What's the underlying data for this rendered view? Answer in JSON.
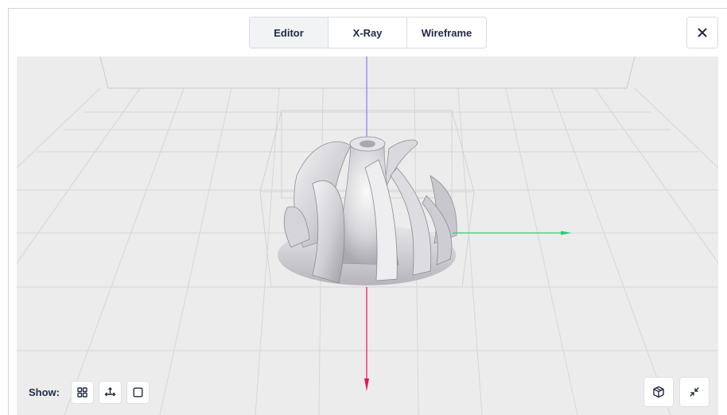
{
  "tabs": [
    {
      "label": "Editor",
      "active": true
    },
    {
      "label": "X-Ray",
      "active": false
    },
    {
      "label": "Wireframe",
      "active": false
    }
  ],
  "close": {
    "icon": "close-icon"
  },
  "viewport": {
    "background": "#ececed",
    "model": "impeller",
    "axes": {
      "x_color": "#2ecc71",
      "y_color": "#8e7cf0",
      "z_color": "#e8174f"
    }
  },
  "show_bar": {
    "label": "Show:",
    "buttons": [
      {
        "icon": "grid-icon"
      },
      {
        "icon": "axes-icon"
      },
      {
        "icon": "bounding-box-icon"
      }
    ]
  },
  "corner_controls": [
    {
      "icon": "cube-view-icon"
    },
    {
      "icon": "collapse-icon"
    }
  ]
}
